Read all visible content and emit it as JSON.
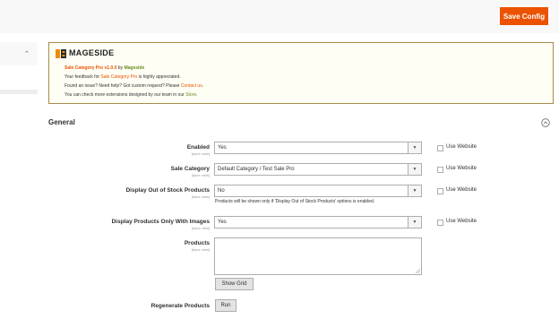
{
  "header": {
    "save_label": "Save Config"
  },
  "mageside": {
    "brand": "MAGESIDE",
    "line1_product": "Sale Category Pro v1.0.0",
    "line1_by": " by ",
    "line1_vendor": "Mageside",
    "line2_pre": "Your feedback for ",
    "line2_link": "Sale Category Pro",
    "line2_post": " is highly appreciated.",
    "line3_pre": "Found an issue? Need help? Got custom request? Please ",
    "line3_link": "Contact us",
    "line3_post": ".",
    "line4_pre": "You can check more extensions designed by our team in our ",
    "line4_link": "Store",
    "line4_post": "."
  },
  "section": {
    "title": "General"
  },
  "fields": [
    {
      "label": "Enabled",
      "scope": "[store view]",
      "value": "Yes",
      "use_website": "Use Website"
    },
    {
      "label": "Sale Category",
      "scope": "[store view]",
      "value": "Default Category / Test Sale Pro",
      "use_website": "Use Website"
    },
    {
      "label": "Display Out of Stock Products",
      "scope": "[store view]",
      "value": "No",
      "use_website": "Use Website",
      "note": "Products will be shown only if 'Display Out of Stock Products' options is enabled."
    },
    {
      "label": "Display Products Only With Images",
      "scope": "[store view]",
      "value": "Yes",
      "use_website": "Use Website"
    },
    {
      "label": "Products",
      "scope": "[store view]",
      "button": "Show Grid"
    },
    {
      "label": "Regenerate Products",
      "button": "Run"
    }
  ],
  "icons": {
    "sidebar_chevron": "chevron-up-icon",
    "logo": "mageside-logo-icon",
    "collapse": "collapse-circle-icon",
    "select_arrow": "dropdown-arrow-icon"
  },
  "colors": {
    "accent": "#eb5202",
    "link_green": "#6a8d22",
    "notice_border": "#a38d4a"
  }
}
